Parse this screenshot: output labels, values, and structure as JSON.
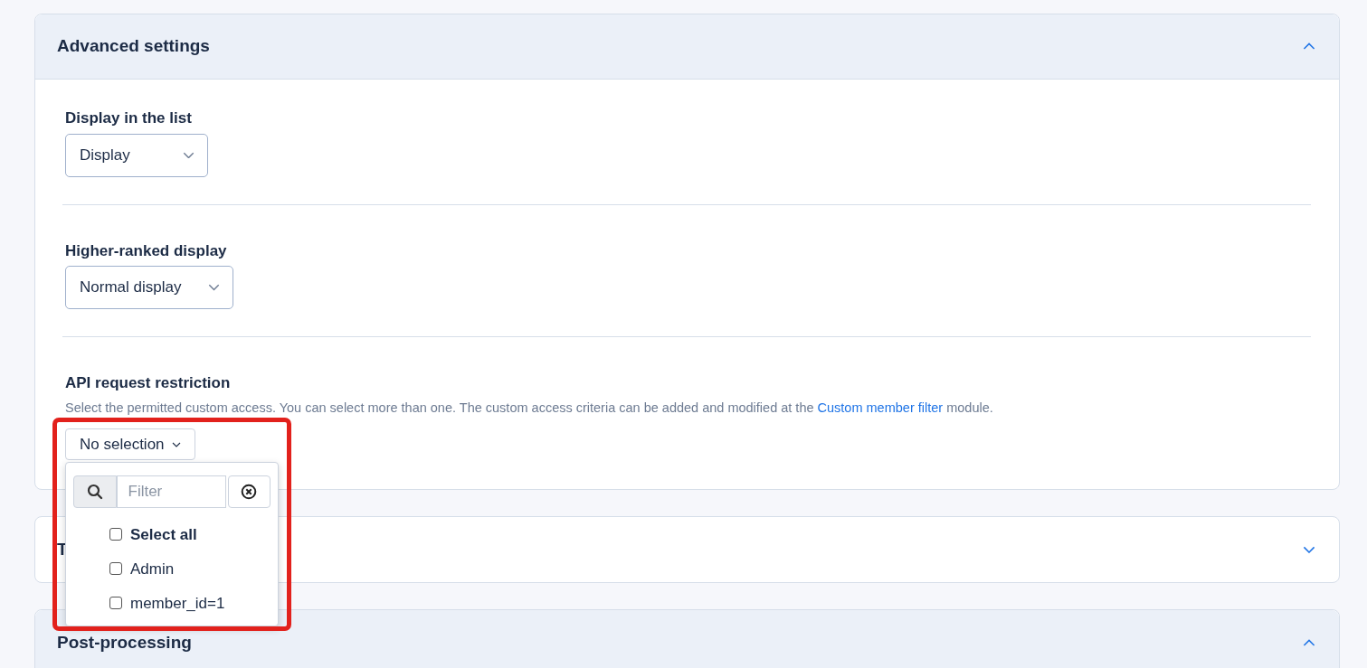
{
  "accordions": [
    {
      "title": "Advanced settings",
      "expanded": true,
      "fields": [
        {
          "kind": "select",
          "label": "Display in the list",
          "value": "Display"
        },
        {
          "kind": "select",
          "label": "Higher-ranked display",
          "value": "Normal display"
        },
        {
          "kind": "multiselect",
          "label": "API request restriction",
          "help_before": "Select the permitted custom access. You can select more than one. The custom access criteria can be added and modified at the ",
          "help_link": "Custom member filter",
          "help_after": " module.",
          "value": "No selection",
          "menu": {
            "filter_placeholder": "Filter",
            "options": [
              {
                "kind": "select_all",
                "label": "Select all",
                "checked": false
              },
              {
                "kind": "option",
                "label": "Admin",
                "checked": false
              },
              {
                "kind": "option",
                "label": "member_id=1",
                "checked": false
              }
            ]
          }
        }
      ]
    },
    {
      "title": "T",
      "expanded": false
    },
    {
      "title": "Post-processing",
      "expanded": true
    }
  ]
}
